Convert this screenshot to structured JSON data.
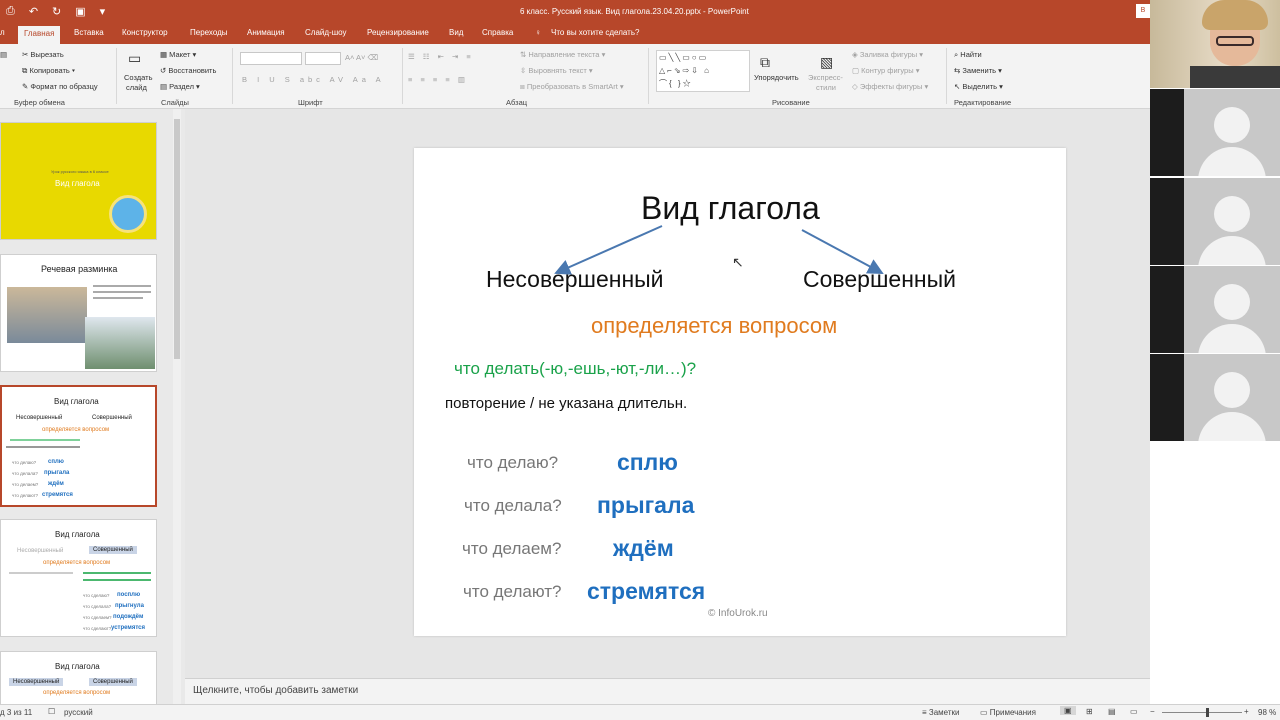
{
  "window": {
    "title": "6 класс. Русский язык. Вид глагола.23.04.20.pptx  -  PowerPoint",
    "right_button": "В"
  },
  "tabs": [
    {
      "label": "л"
    },
    {
      "label": "Главная"
    },
    {
      "label": "Вставка"
    },
    {
      "label": "Конструктор"
    },
    {
      "label": "Переходы"
    },
    {
      "label": "Анимация"
    },
    {
      "label": "Слайд-шоу"
    },
    {
      "label": "Рецензирование"
    },
    {
      "label": "Вид"
    },
    {
      "label": "Справка"
    },
    {
      "label": "Что вы хотите сделать?"
    }
  ],
  "ribbon": {
    "clipboard": {
      "cut": "Вырезать",
      "copy": "Копировать",
      "format": "Формат по образцу",
      "group": "Буфер обмена"
    },
    "slides": {
      "new_slide_1": "Создать",
      "new_slide_2": "слайд",
      "layout": "Макет",
      "reset": "Восстановить",
      "section": "Раздел",
      "group": "Слайды"
    },
    "font": {
      "group": "Шрифт"
    },
    "paragraph": {
      "text_dir": "Направление текста",
      "align_text": "Выровнять текст",
      "smartart": "Преобразовать в SmartArt",
      "group": "Абзац"
    },
    "drawing": {
      "arrange": "Упорядочить",
      "quick_1": "Экспресс-",
      "quick_2": "стили",
      "fill": "Заливка фигуры",
      "outline": "Контур фигуры",
      "effects": "Эффекты фигуры",
      "group": "Рисование"
    },
    "editing": {
      "find": "Найти",
      "replace": "Заменить",
      "select": "Выделить",
      "group": "Редактирование"
    }
  },
  "thumbnails": [
    {
      "title": "Вид глагола",
      "subtitle": "Урок русского языка в 6 классе"
    },
    {
      "title": "Речевая разминка"
    },
    {
      "title": "Вид глагола",
      "left": "Несовершенный",
      "right": "Совершенный",
      "orange": "определяется вопросом",
      "q1": "что делаю?",
      "q2": "что делала?",
      "q3": "что делаем?",
      "q4": "что делают?",
      "a1": "сплю",
      "a2": "прыгала",
      "a3": "ждём",
      "a4": "стремятся"
    },
    {
      "title": "Вид глагола",
      "left": "Несовершенный",
      "right": "Совершенный",
      "orange": "определяется вопросом",
      "q1": "что сделаю?",
      "q2": "что сделала?",
      "q3": "что сделаем?",
      "q4": "что сделают?",
      "a1": "посплю",
      "a2": "прыгнула",
      "a3": "подождём",
      "a4": "устремятся"
    },
    {
      "title": "Вид глагола",
      "left": "Несовершенный",
      "right": "Совершенный",
      "orange": "определяется вопросом"
    }
  ],
  "slide": {
    "title": "Вид глагола",
    "left": "Несовершенный",
    "right": "Совершенный",
    "orange": "определяется вопросом",
    "green": "что делать(-ю,-ешь,-ют,-ли…)?",
    "note": "повторение / не указана длительн.",
    "rows": [
      {
        "q": "что делаю?",
        "a": "сплю"
      },
      {
        "q": "что делала?",
        "a": "прыгала"
      },
      {
        "q": "что делаем?",
        "a": "ждём"
      },
      {
        "q": "что делают?",
        "a": "стремятся"
      }
    ],
    "watermark": "© InfoUrok.ru"
  },
  "notes": {
    "placeholder": "Щелкните, чтобы добавить заметки"
  },
  "status": {
    "slide": "д 3 из 11",
    "language": "русский",
    "notes_btn": "Заметки",
    "comments_btn": "Примечания",
    "zoom": "98 %"
  },
  "colors": {
    "accent": "#b7472a",
    "orange": "#e07b1f",
    "green": "#1aa24a",
    "blue": "#1f6fbf"
  }
}
